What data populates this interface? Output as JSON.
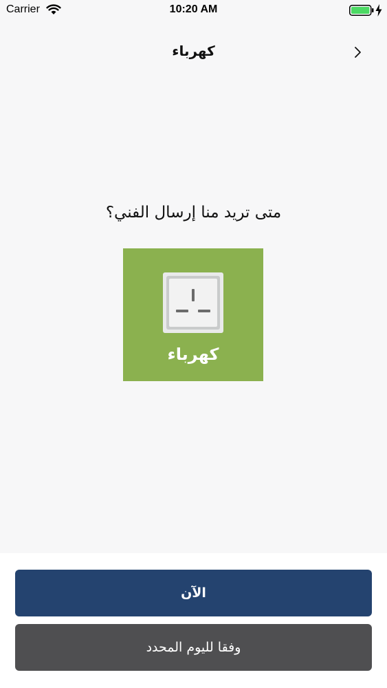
{
  "status_bar": {
    "carrier": "Carrier",
    "time": "10:20 AM",
    "battery_color": "#4cd964"
  },
  "nav": {
    "title": "كهرباء",
    "back_icon": "chevron-right-icon"
  },
  "question": "متى تريد منا إرسال الفني؟",
  "service": {
    "label": "كهرباء",
    "icon": "power-socket-icon",
    "color": "#8bb14f"
  },
  "actions": {
    "now_label": "الآن",
    "scheduled_label": "وفقا لليوم المحدد",
    "now_color": "#24436f",
    "scheduled_color": "#4f4f51"
  }
}
